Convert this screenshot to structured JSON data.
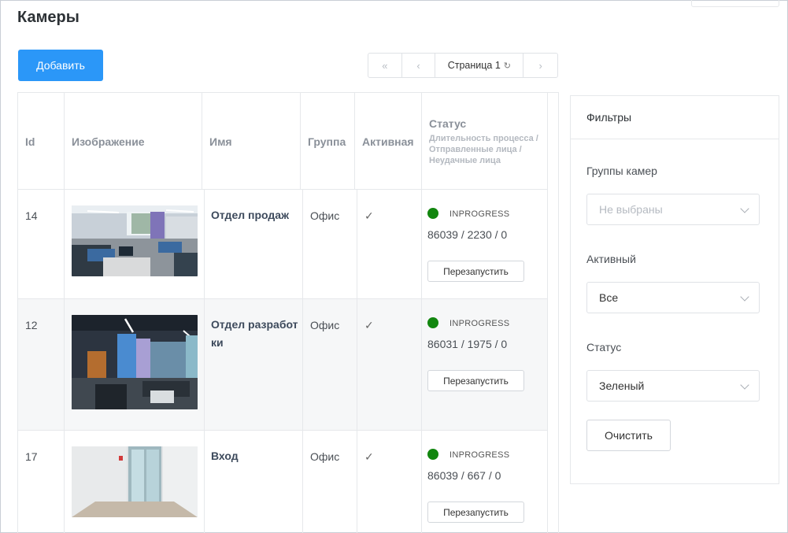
{
  "page": {
    "title": "Камеры"
  },
  "toolbar": {
    "add_label": "Добавить"
  },
  "pager": {
    "first_icon": "«",
    "prev_icon": "‹",
    "page_label": "Страница 1",
    "refresh_icon": "↻",
    "next_icon": "›"
  },
  "table": {
    "headers": {
      "id": "Id",
      "image": "Изображение",
      "name": "Имя",
      "group": "Группа",
      "active": "Активная",
      "status": "Статус",
      "status_sub": "Длительность процесса / Отправленные лица / Неудачные лица"
    },
    "rows": [
      {
        "id": "14",
        "name": "Отдел продаж",
        "group": "Офис",
        "active": "✓",
        "status": "INPROGRESS",
        "counts": "86039 / 2230 / 0",
        "restart": "Перезапустить",
        "thumb": "office-sales"
      },
      {
        "id": "12",
        "name": "Отдел разработки",
        "group": "Офис",
        "active": "✓",
        "status": "INPROGRESS",
        "counts": "86031 / 1975 / 0",
        "restart": "Перезапустить",
        "thumb": "office-dev"
      },
      {
        "id": "17",
        "name": "Вход",
        "group": "Офис",
        "active": "✓",
        "status": "INPROGRESS",
        "counts": "86039 / 667 / 0",
        "restart": "Перезапустить",
        "thumb": "entrance"
      }
    ],
    "status_color": "#12860f"
  },
  "filters": {
    "title": "Фильтры",
    "camera_groups_label": "Группы камер",
    "camera_groups_placeholder": "Не выбраны",
    "active_label": "Активный",
    "active_value": "Все",
    "status_label": "Статус",
    "status_value": "Зеленый",
    "clear_label": "Очистить"
  },
  "colors": {
    "accent": "#2b97f8"
  }
}
